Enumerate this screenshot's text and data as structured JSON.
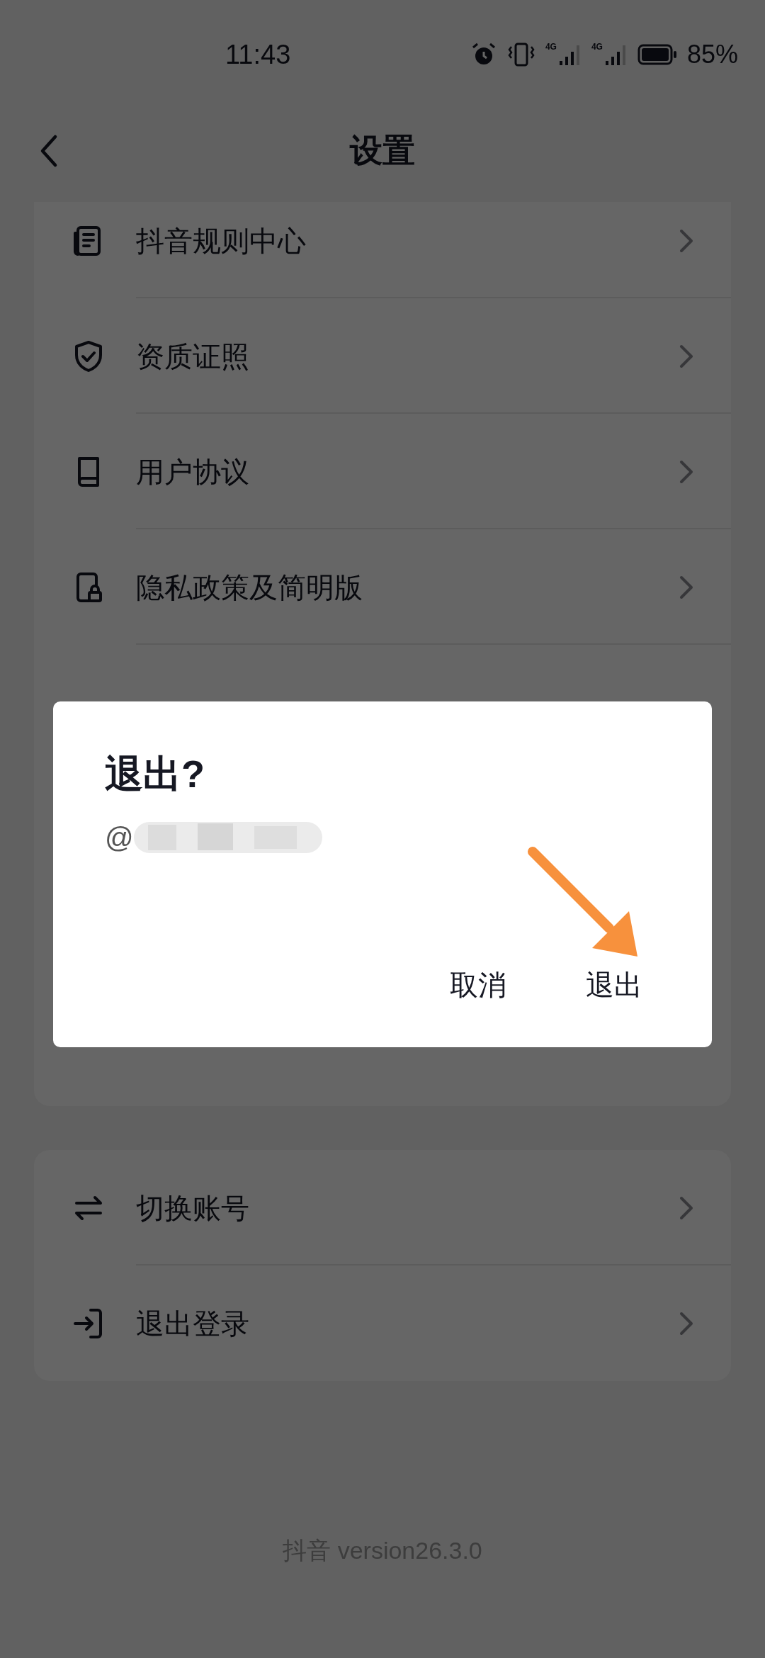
{
  "status_bar": {
    "time": "11:43",
    "networks": [
      {
        "label": "4G"
      },
      {
        "label": "4G"
      }
    ],
    "battery": "85%"
  },
  "header": {
    "title": "设置"
  },
  "settings_card": [
    {
      "label": "抖音规则中心"
    },
    {
      "label": "资质证照"
    },
    {
      "label": "用户协议"
    },
    {
      "label": "隐私政策及简明版"
    }
  ],
  "account_card": [
    {
      "label": "切换账号"
    },
    {
      "label": "退出登录"
    }
  ],
  "footer": "抖音 version26.3.0",
  "dialog": {
    "title": "退出?",
    "account": "@",
    "buttons": [
      "取消",
      "退出"
    ]
  }
}
